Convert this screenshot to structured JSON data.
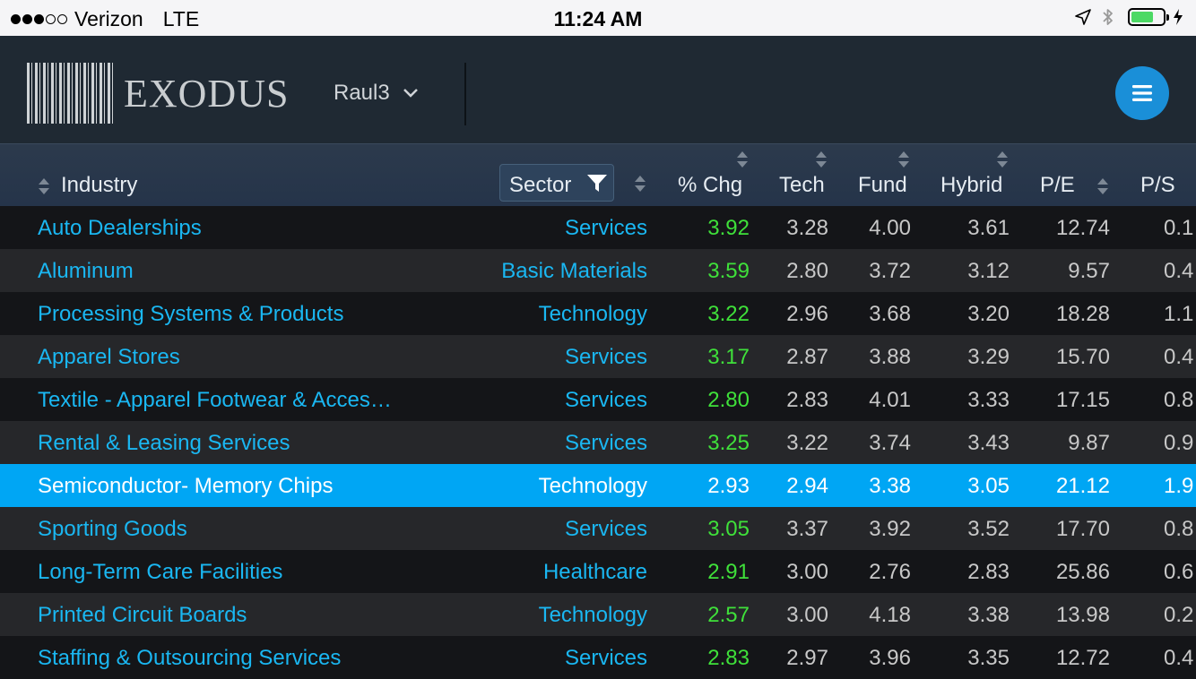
{
  "status_bar": {
    "signal_dots": 5,
    "signal_filled": 3,
    "carrier": "Verizon",
    "network": "LTE",
    "time": "11:24 AM",
    "battery_level": 0.7,
    "battery_color": "#4cd964"
  },
  "header": {
    "logo_text": "EXODUS",
    "profile_name": "Raul3",
    "accent": "#1a8fd8",
    "icons": [
      "barcode-logo-icon",
      "chevron-down-icon",
      "hamburger-menu-icon"
    ]
  },
  "columns": {
    "industry": "Industry",
    "sector": "Sector",
    "chg": "% Chg",
    "tech": "Tech",
    "fund": "Fund",
    "hybrid": "Hybrid",
    "pe": "P/E",
    "ps": "P/S"
  },
  "rows": [
    {
      "industry": "Auto Dealerships",
      "sector": "Services",
      "chg": "3.92",
      "tech": "3.28",
      "fund": "4.00",
      "hybrid": "3.61",
      "pe": "12.74",
      "ps": "0.1"
    },
    {
      "industry": "Aluminum",
      "sector": "Basic Materials",
      "chg": "3.59",
      "tech": "2.80",
      "fund": "3.72",
      "hybrid": "3.12",
      "pe": "9.57",
      "ps": "0.4"
    },
    {
      "industry": "Processing Systems & Products",
      "sector": "Technology",
      "chg": "3.22",
      "tech": "2.96",
      "fund": "3.68",
      "hybrid": "3.20",
      "pe": "18.28",
      "ps": "1.1"
    },
    {
      "industry": "Apparel Stores",
      "sector": "Services",
      "chg": "3.17",
      "tech": "2.87",
      "fund": "3.88",
      "hybrid": "3.29",
      "pe": "15.70",
      "ps": "0.4"
    },
    {
      "industry": "Textile - Apparel Footwear & Acces…",
      "sector": "Services",
      "chg": "2.80",
      "tech": "2.83",
      "fund": "4.01",
      "hybrid": "3.33",
      "pe": "17.15",
      "ps": "0.8"
    },
    {
      "industry": "Rental & Leasing Services",
      "sector": "Services",
      "chg": "3.25",
      "tech": "3.22",
      "fund": "3.74",
      "hybrid": "3.43",
      "pe": "9.87",
      "ps": "0.9"
    },
    {
      "industry": "Semiconductor- Memory Chips",
      "sector": "Technology",
      "chg": "2.93",
      "tech": "2.94",
      "fund": "3.38",
      "hybrid": "3.05",
      "pe": "21.12",
      "ps": "1.9"
    },
    {
      "industry": "Sporting Goods",
      "sector": "Services",
      "chg": "3.05",
      "tech": "3.37",
      "fund": "3.92",
      "hybrid": "3.52",
      "pe": "17.70",
      "ps": "0.8"
    },
    {
      "industry": "Long-Term Care Facilities",
      "sector": "Healthcare",
      "chg": "2.91",
      "tech": "3.00",
      "fund": "2.76",
      "hybrid": "2.83",
      "pe": "25.86",
      "ps": "0.6"
    },
    {
      "industry": "Printed Circuit Boards",
      "sector": "Technology",
      "chg": "2.57",
      "tech": "3.00",
      "fund": "4.18",
      "hybrid": "3.38",
      "pe": "13.98",
      "ps": "0.2"
    },
    {
      "industry": "Staffing & Outsourcing Services",
      "sector": "Services",
      "chg": "2.83",
      "tech": "2.97",
      "fund": "3.96",
      "hybrid": "3.35",
      "pe": "12.72",
      "ps": "0.4"
    }
  ],
  "selected_row": 6,
  "colors": {
    "link": "#1ab7f2",
    "positive": "#3fe03a",
    "selected": "#00a6f4"
  }
}
